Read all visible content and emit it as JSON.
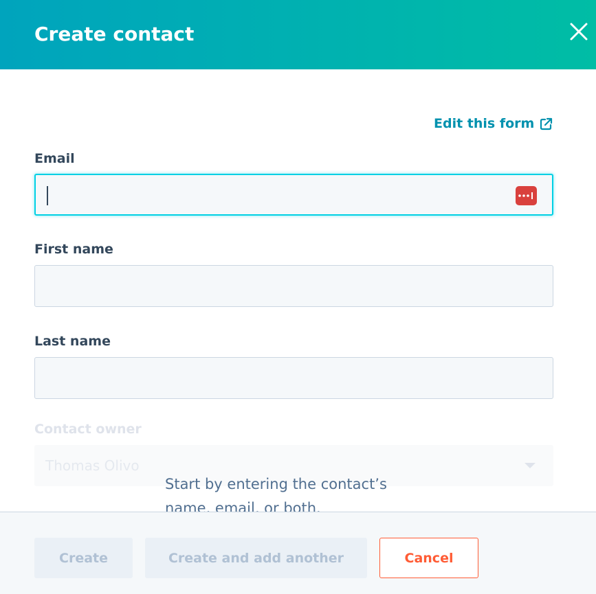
{
  "modal": {
    "title": "Create contact"
  },
  "form": {
    "edit_link": "Edit this form",
    "email": {
      "label": "Email",
      "value": ""
    },
    "first_name": {
      "label": "First name",
      "value": ""
    },
    "last_name": {
      "label": "Last name",
      "value": ""
    },
    "contact_owner": {
      "label": "Contact owner",
      "value": "Thomas Olivo"
    },
    "hint": "Start by entering the contact’s name, email, or both."
  },
  "footer": {
    "create_label": "Create",
    "create_another_label": "Create and add another",
    "cancel_label": "Cancel"
  },
  "colors": {
    "header_start": "#00a4bd",
    "header_end": "#00bda5",
    "link": "#0091ae",
    "focus_border": "#00d0e4",
    "password_icon": "#d9413d",
    "cancel": "#ff5c35"
  },
  "icons": {
    "close": "close-icon",
    "external_link": "external-link-icon",
    "password_manager": "password-manager-icon",
    "dropdown": "chevron-down-icon"
  }
}
